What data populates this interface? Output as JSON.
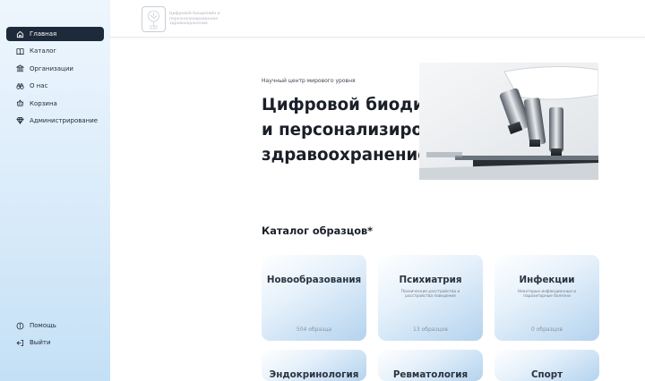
{
  "app": {
    "logo_text": "Цифровой биодизайн и персонализированное здравоохранение",
    "logo_abbr": "НЦМУ"
  },
  "sidebar": {
    "items": [
      {
        "label": "Главная",
        "icon": "home-icon",
        "active": true
      },
      {
        "label": "Каталог",
        "icon": "book-icon",
        "active": false
      },
      {
        "label": "Организации",
        "icon": "institution-icon",
        "active": false
      },
      {
        "label": "О нас",
        "icon": "binoculars-icon",
        "active": false
      },
      {
        "label": "Корзина",
        "icon": "cart-icon",
        "active": false
      },
      {
        "label": "Администрирование",
        "icon": "diamond-icon",
        "active": false
      }
    ],
    "bottom_items": [
      {
        "label": "Помощь",
        "icon": "info-icon"
      },
      {
        "label": "Выйти",
        "icon": "logout-icon"
      }
    ]
  },
  "hero": {
    "subtitle": "Научный центр мирового уровня",
    "title_line1": "Цифровой биодизайн",
    "title_line2": "и персонализированное",
    "title_line3": "здравоохранение",
    "image": "microscope-photo"
  },
  "catalog": {
    "title": "Каталог образцов*",
    "cards": [
      {
        "title": "Новообразования",
        "description": "",
        "count": "504 образца"
      },
      {
        "title": "Психиатрия",
        "description": "Психические расстройства и расстройства поведения",
        "count": "13 образцов"
      },
      {
        "title": "Инфекции",
        "description": "Некоторые инфекционные и паразитарные болезни",
        "count": "0 образцов"
      },
      {
        "title": "Эндокринология",
        "description": "",
        "count": ""
      },
      {
        "title": "Ревматология",
        "description": "",
        "count": ""
      },
      {
        "title": "Спорт",
        "description": "",
        "count": ""
      }
    ]
  },
  "colors": {
    "active_nav_bg": "#1c2a3a",
    "sidebar_gradient_top": "#eef6fd",
    "sidebar_gradient_bottom": "#c4e0f6",
    "card_gradient_end": "#b4d3ee"
  }
}
